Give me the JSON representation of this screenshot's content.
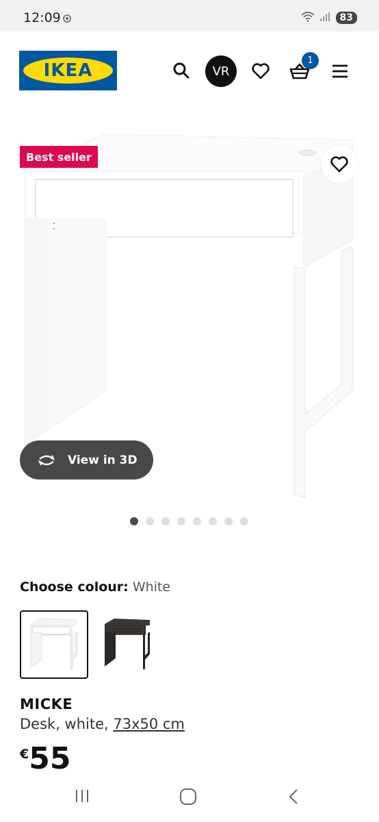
{
  "status_bar": {
    "time": "12:09",
    "battery": "83"
  },
  "header": {
    "logo_text": "IKEA",
    "avatar_initials": "VR",
    "cart_count": "1"
  },
  "product_image": {
    "badge": "Best seller",
    "view_3d_label": "View in 3D",
    "dots_total": 8,
    "dots_active_index": 0
  },
  "colour": {
    "label": "Choose colour:",
    "selected_value": "White",
    "options": [
      "white",
      "black-brown"
    ]
  },
  "product": {
    "name": "MICKE",
    "description": "Desk, white,",
    "dimensions": "73x50 cm",
    "price_currency": "€",
    "price_value": "55"
  },
  "colors": {
    "ikea_blue": "#0058a3",
    "ikea_yellow": "#ffdb00",
    "best_seller_bg": "#e00751",
    "view3d_bg": "#484848"
  },
  "icons": [
    "search-icon",
    "heart-icon",
    "basket-icon",
    "menu-icon",
    "rotate-3d-icon",
    "recent-apps-icon",
    "home-icon",
    "back-icon"
  ]
}
